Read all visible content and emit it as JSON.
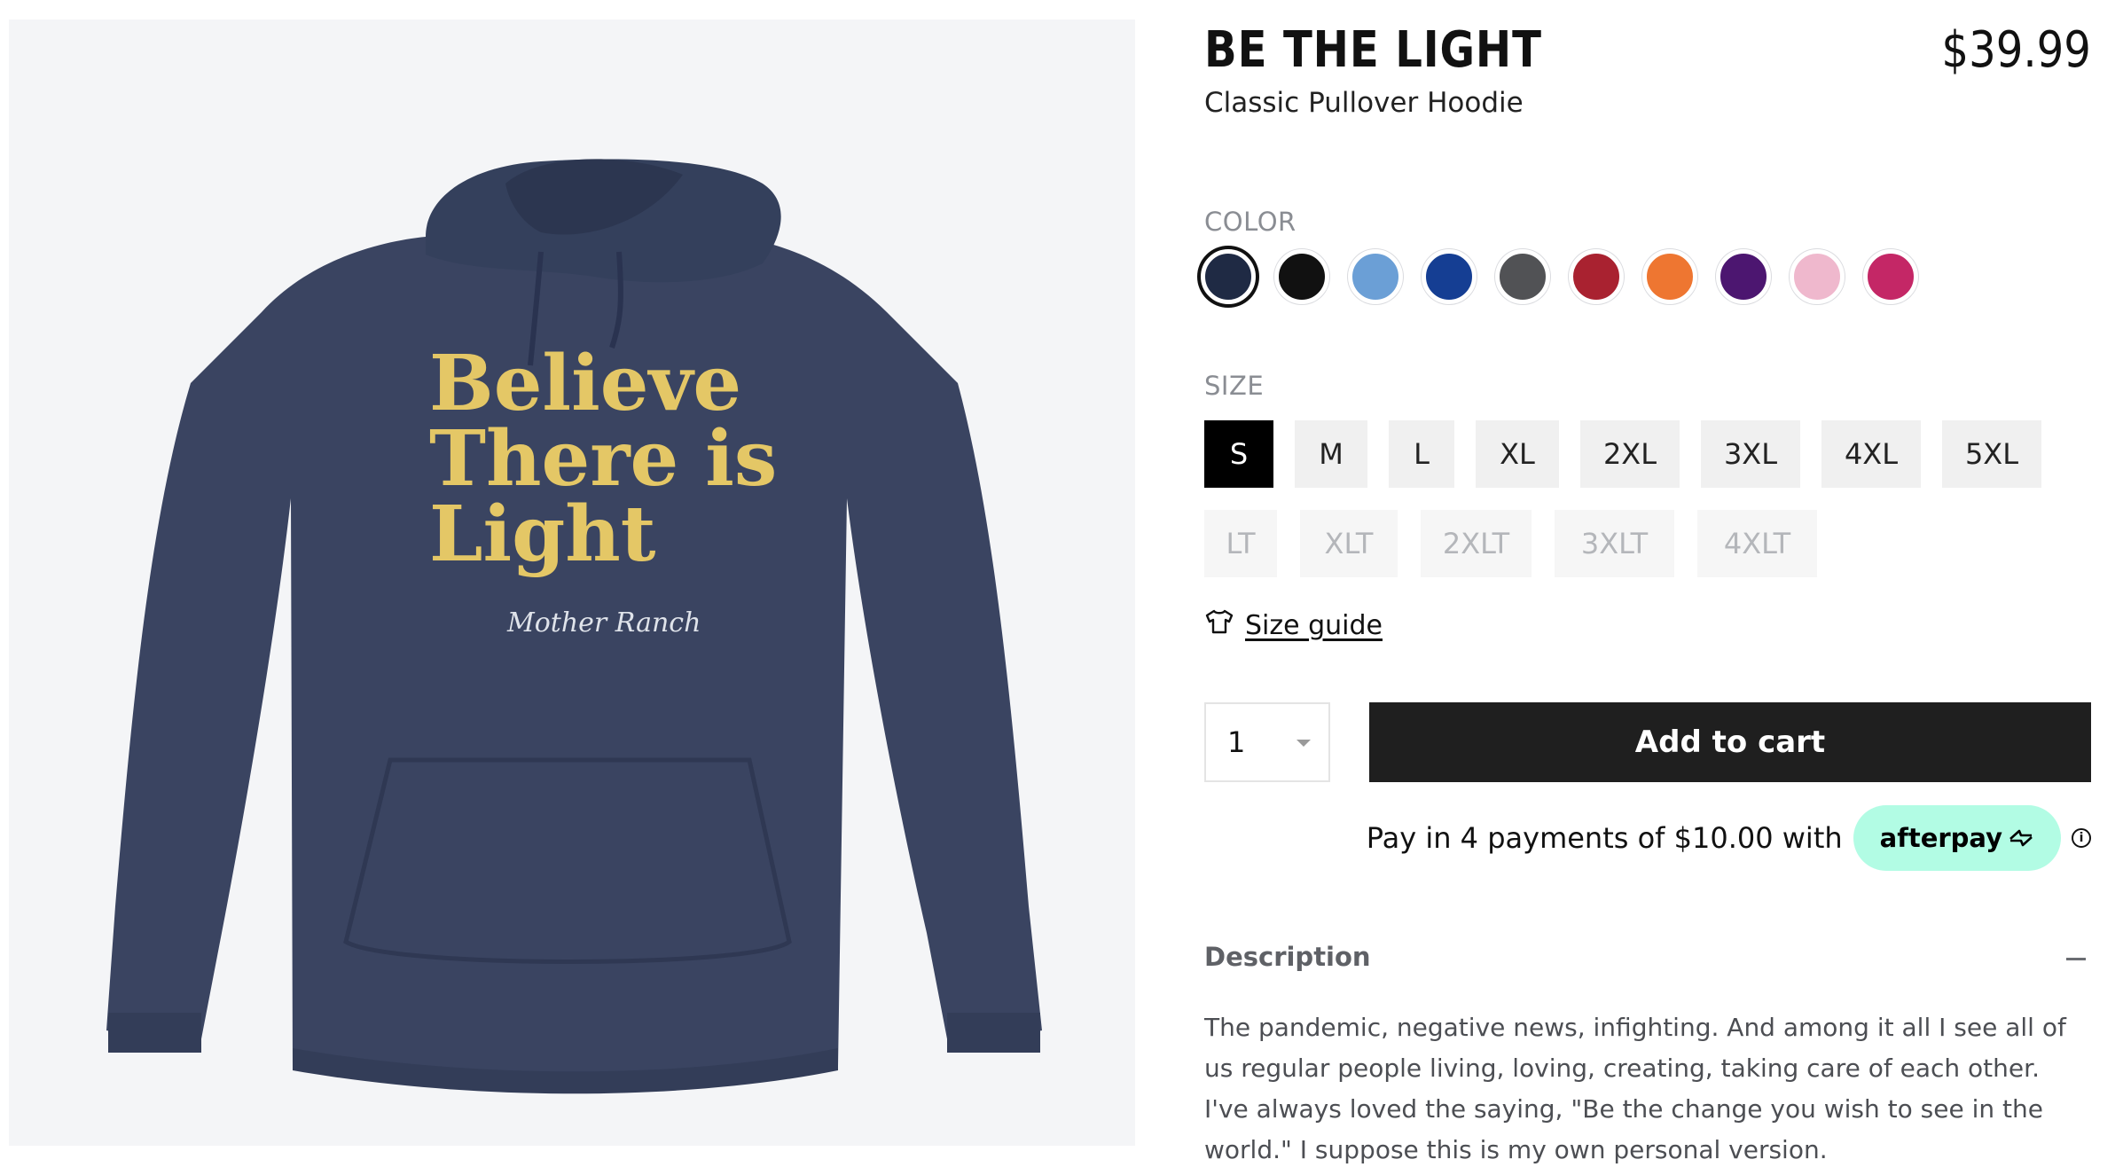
{
  "product": {
    "title": "BE THE LIGHT",
    "price": "$39.99",
    "subtitle": "Classic Pullover Hoodie",
    "image": {
      "print_lines": [
        "Believe",
        "There is",
        "Light"
      ],
      "signature": "Mother Ranch"
    }
  },
  "color": {
    "label": "COLOR",
    "swatches": [
      {
        "name": "Navy",
        "hex": "#1f2a44",
        "selected": true
      },
      {
        "name": "Black",
        "hex": "#111111"
      },
      {
        "name": "Carolina Blue",
        "hex": "#6b9fd6"
      },
      {
        "name": "Royal",
        "hex": "#153e93"
      },
      {
        "name": "Charcoal",
        "hex": "#515255"
      },
      {
        "name": "Red",
        "hex": "#a92230"
      },
      {
        "name": "Orange",
        "hex": "#ee7631"
      },
      {
        "name": "Purple",
        "hex": "#4c1670"
      },
      {
        "name": "Pink",
        "hex": "#efb8cd"
      },
      {
        "name": "Raspberry",
        "hex": "#c42766"
      }
    ]
  },
  "size": {
    "label": "SIZE",
    "options_row1": [
      "S",
      "M",
      "L",
      "XL",
      "2XL",
      "3XL",
      "4XL",
      "5XL"
    ],
    "options_row2": [
      "LT",
      "XLT",
      "2XLT",
      "3XLT",
      "4XLT"
    ],
    "selected": "S"
  },
  "size_guide": {
    "label": "Size guide",
    "icon": "tshirt-icon"
  },
  "quantity": {
    "value": "1"
  },
  "cart": {
    "add_label": "Add to cart"
  },
  "afterpay": {
    "text": "Pay in 4 payments of $10.00 with",
    "brand": "afterpay",
    "info": "i"
  },
  "description": {
    "heading": "Description",
    "body": "The pandemic, negative news, infighting. And among it all I see all of us regular people living, loving, creating, taking care of each other. I've always loved the saying, \"Be the change you wish to see in the world.\" I suppose this is my own personal version."
  },
  "colors": {
    "accent": "#1f1f1f",
    "afterpay_mint": "#b2fce4"
  }
}
